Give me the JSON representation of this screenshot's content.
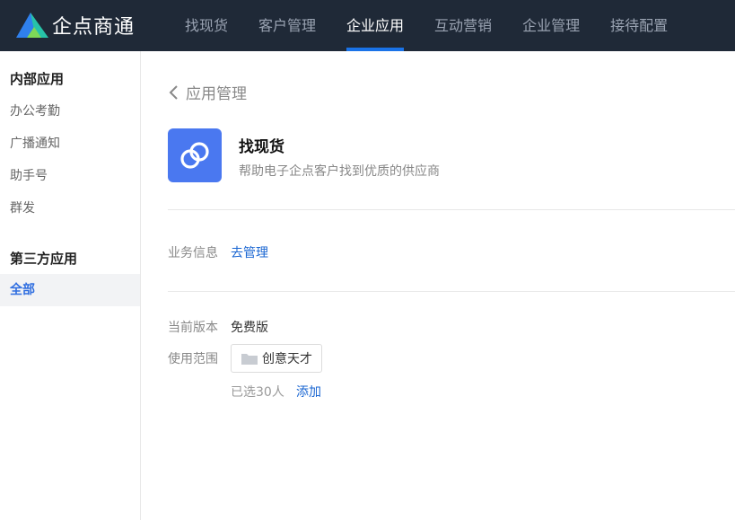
{
  "brand": {
    "name": "企点商通",
    "logo_icon": "qidian-logo-icon"
  },
  "nav": {
    "items": [
      {
        "label": "找现货",
        "active": false
      },
      {
        "label": "客户管理",
        "active": false
      },
      {
        "label": "企业应用",
        "active": true
      },
      {
        "label": "互动营销",
        "active": false
      },
      {
        "label": "企业管理",
        "active": false
      },
      {
        "label": "接待配置",
        "active": false
      }
    ],
    "accent_color": "#1a73e8"
  },
  "sidebar": {
    "internal_title": "内部应用",
    "internal_items": [
      "办公考勤",
      "广播通知",
      "助手号",
      "群发"
    ],
    "third_party_title": "第三方应用",
    "third_party_items": [
      {
        "label": "全部",
        "active": true
      }
    ]
  },
  "main": {
    "back_label": "应用管理",
    "app": {
      "name": "找现货",
      "description": "帮助电子企点客户找到优质的供应商",
      "icon": "link-chain-icon",
      "icon_bg": "#4a78f0"
    },
    "business_info": {
      "label": "业务信息",
      "action": "去管理"
    },
    "version": {
      "label": "当前版本",
      "value": "免费版"
    },
    "scope": {
      "label": "使用范围",
      "tag": "创意天才",
      "selected_count": "已选30人",
      "add_label": "添加"
    }
  }
}
